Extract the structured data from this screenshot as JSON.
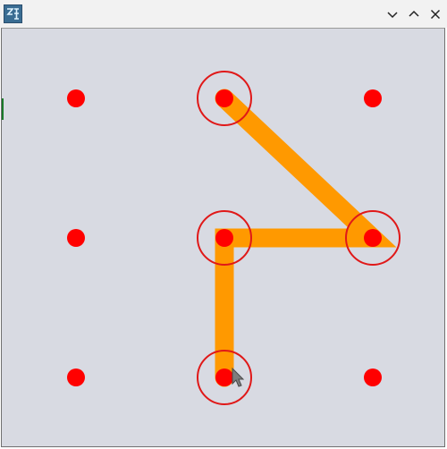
{
  "window": {
    "title": "",
    "icon": "app-logo-icon",
    "controls": {
      "minimize": "chevron-down-icon",
      "maximize": "chevron-up-icon",
      "close": "close-icon"
    }
  },
  "colors": {
    "background": "#d8dae2",
    "dot": "#ff0000",
    "ring": "#e01818",
    "line": "#ff9900",
    "titlebar": "#f2f2f2"
  },
  "pattern": {
    "grid": {
      "rows": 3,
      "cols": 3
    },
    "sequence": [
      {
        "row": 0,
        "col": 1
      },
      {
        "row": 1,
        "col": 2
      },
      {
        "row": 1,
        "col": 1
      },
      {
        "row": 2,
        "col": 1
      }
    ],
    "selected_count": 4
  }
}
